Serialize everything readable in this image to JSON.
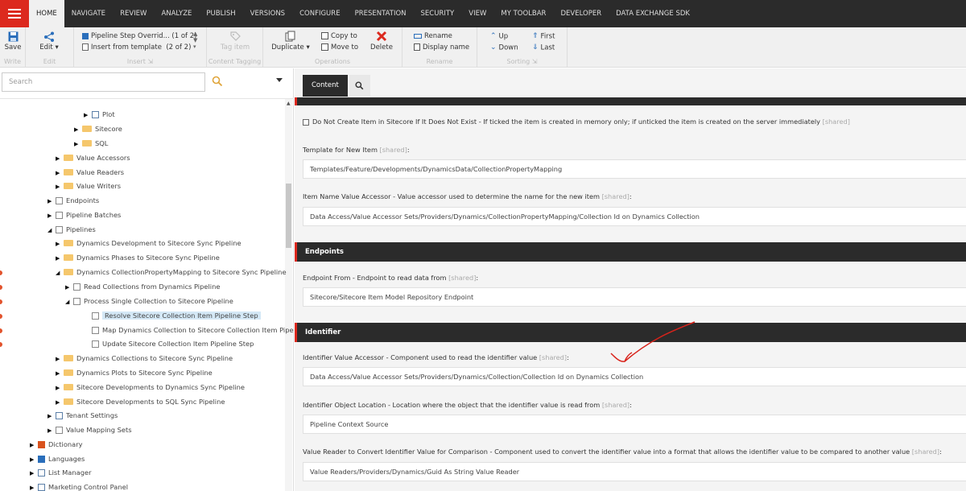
{
  "topnav": {
    "tabs": [
      "HOME",
      "NAVIGATE",
      "REVIEW",
      "ANALYZE",
      "PUBLISH",
      "VERSIONS",
      "CONFIGURE",
      "PRESENTATION",
      "SECURITY",
      "VIEW",
      "MY TOOLBAR",
      "DEVELOPER",
      "DATA EXCHANGE SDK"
    ],
    "active": "HOME"
  },
  "ribbon": {
    "write": {
      "save": "Save",
      "label": "Write"
    },
    "edit": {
      "edit": "Edit",
      "label": "Edit"
    },
    "insert": {
      "item1": "Pipeline Step Overrid...",
      "item1_count": "(1 of 2)",
      "item2": "Insert from template",
      "item2_count": "(2 of 2)",
      "label": "Insert"
    },
    "tagging": {
      "tag_item": "Tag item",
      "label": "Content Tagging"
    },
    "operations": {
      "duplicate": "Duplicate",
      "copy_to": "Copy to",
      "move_to": "Move to",
      "delete": "Delete",
      "label": "Operations"
    },
    "rename": {
      "rename": "Rename",
      "display_name": "Display name",
      "label": "Rename"
    },
    "sorting": {
      "up": "Up",
      "down": "Down",
      "first": "First",
      "last": "Last",
      "label": "Sorting"
    }
  },
  "search": {
    "placeholder": "Search"
  },
  "tree": [
    {
      "label": "Plot",
      "icon": "list-icon",
      "arrow": "▶"
    },
    {
      "label": "Sitecore",
      "icon": "folder-icon",
      "arrow": "▶"
    },
    {
      "label": "SQL",
      "icon": "folder-icon",
      "arrow": "▶"
    },
    {
      "label": "Value Accessors",
      "icon": "folder-icon",
      "arrow": "▶"
    },
    {
      "label": "Value Readers",
      "icon": "folder-icon",
      "arrow": "▶"
    },
    {
      "label": "Value Writers",
      "icon": "folder-icon",
      "arrow": "▶"
    },
    {
      "label": "Endpoints",
      "icon": "cloud-icon",
      "arrow": "▶"
    },
    {
      "label": "Pipeline Batches",
      "icon": "batch-icon",
      "arrow": "▶"
    },
    {
      "label": "Pipelines",
      "icon": "pipeline-icon",
      "arrow": "◢"
    },
    {
      "label": "Dynamics Development to Sitecore Sync Pipeline",
      "icon": "folder-icon",
      "arrow": "▶"
    },
    {
      "label": "Dynamics Phases to Sitecore Sync Pipeline",
      "icon": "folder-icon",
      "arrow": "▶"
    },
    {
      "label": "Dynamics CollectionPropertyMapping to Sitecore Sync Pipeline",
      "icon": "folder-icon",
      "arrow": "◢"
    },
    {
      "label": "Read Collections from Dynamics Pipeline",
      "icon": "pipeline-icon",
      "arrow": "▶"
    },
    {
      "label": "Process Single Collection to Sitecore Pipeline",
      "icon": "pipeline-icon",
      "arrow": "◢"
    },
    {
      "label": "Resolve Sitecore Collection Item Pipeline Step",
      "icon": "step-icon",
      "arrow": ""
    },
    {
      "label": "Map Dynamics Collection to Sitecore Collection Item Pipeline S",
      "icon": "step-icon",
      "arrow": ""
    },
    {
      "label": "Update Sitecore Collection Item Pipeline Step",
      "icon": "step-icon",
      "arrow": ""
    },
    {
      "label": "Dynamics Collections to Sitecore Sync Pipeline",
      "icon": "folder-icon",
      "arrow": "▶"
    },
    {
      "label": "Dynamics Plots to Sitecore Sync Pipeline",
      "icon": "folder-icon",
      "arrow": "▶"
    },
    {
      "label": "Sitecore Developments to Dynamics Sync Pipeline",
      "icon": "folder-icon",
      "arrow": "▶"
    },
    {
      "label": "Sitecore Developments to SQL Sync Pipeline",
      "icon": "folder-icon",
      "arrow": "▶"
    },
    {
      "label": "Tenant Settings",
      "icon": "settings-doc-icon",
      "arrow": "▶"
    },
    {
      "label": "Value Mapping Sets",
      "icon": "mapping-icon",
      "arrow": "▶"
    },
    {
      "label": "Dictionary",
      "icon": "dictionary-icon",
      "arrow": "▶"
    },
    {
      "label": "Languages",
      "icon": "languages-icon",
      "arrow": "▶"
    },
    {
      "label": "List Manager",
      "icon": "list-manager-icon",
      "arrow": "▶"
    },
    {
      "label": "Marketing Control Panel",
      "icon": "marketing-icon",
      "arrow": "▶"
    }
  ],
  "content": {
    "tab_content": "Content",
    "checkbox_label": "Do Not Create Item in Sitecore If It Does Not Exist - If ticked the item is created in memory only; if unticked the item is created on the server immediately",
    "shared": "[shared]",
    "template_label": "Template for New Item",
    "template_value": "Templates/Feature/Developments/DynamicsData/CollectionPropertyMapping",
    "itemname_label": "Item Name Value Accessor - Value accessor used to determine the name for the new item",
    "itemname_value": "Data Access/Value Accessor Sets/Providers/Dynamics/CollectionPropertyMapping/Collection Id on Dynamics Collection",
    "endpoints_header": "Endpoints",
    "endpoint_from_label": "Endpoint From - Endpoint to read data from",
    "endpoint_from_value": "Sitecore/Sitecore Item Model Repository Endpoint",
    "identifier_header": "Identifier",
    "identifier_accessor_label": "Identifier Value Accessor - Component used to read the identifier value",
    "identifier_accessor_value": "Data Access/Value Accessor Sets/Providers/Dynamics/Collection/Collection Id on Dynamics Collection",
    "identifier_location_label": "Identifier Object Location - Location where the object that the identifier value is read from",
    "identifier_location_value": "Pipeline Context Source",
    "value_reader_label": "Value Reader to Convert Identifier Value for Comparison - Component used to convert the identifier value into a format that allows the identifier value to be compared to another value",
    "value_reader_value": "Value Readers/Providers/Dynamics/Guid As String Value Reader"
  },
  "colors": {
    "accent": "#dc291e",
    "dark": "#2b2b2b",
    "annotation": "#d9231b"
  }
}
